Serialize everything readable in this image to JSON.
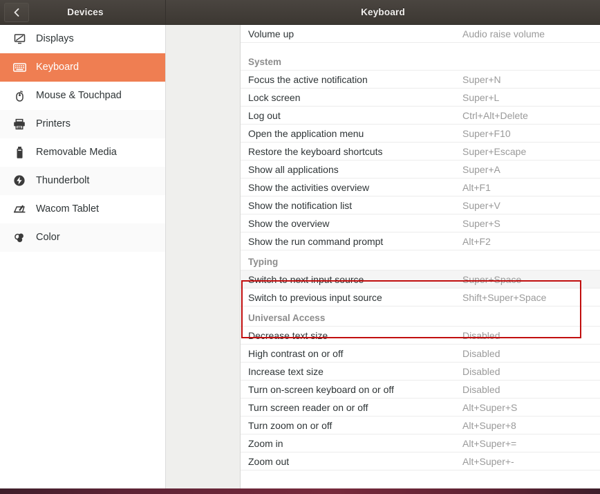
{
  "titlebar": {
    "back_icon": "chevron-left-icon",
    "left_title": "Devices",
    "right_title": "Keyboard"
  },
  "sidebar": {
    "items": [
      {
        "label": "Displays",
        "icon": "display-icon",
        "selected": false
      },
      {
        "label": "Keyboard",
        "icon": "keyboard-icon",
        "selected": true
      },
      {
        "label": "Mouse & Touchpad",
        "icon": "mouse-icon",
        "selected": false
      },
      {
        "label": "Printers",
        "icon": "printer-icon",
        "selected": false
      },
      {
        "label": "Removable Media",
        "icon": "usb-drive-icon",
        "selected": false
      },
      {
        "label": "Thunderbolt",
        "icon": "thunderbolt-icon",
        "selected": false
      },
      {
        "label": "Wacom Tablet",
        "icon": "wacom-tablet-icon",
        "selected": false
      },
      {
        "label": "Color",
        "icon": "color-profile-icon",
        "selected": false
      }
    ]
  },
  "shortcuts": {
    "rows": [
      {
        "type": "row",
        "action": "Volume up",
        "key": "Audio raise volume"
      },
      {
        "type": "section",
        "action": "System",
        "key": ""
      },
      {
        "type": "row",
        "action": "Focus the active notification",
        "key": "Super+N"
      },
      {
        "type": "row",
        "action": "Lock screen",
        "key": "Super+L"
      },
      {
        "type": "row",
        "action": "Log out",
        "key": "Ctrl+Alt+Delete"
      },
      {
        "type": "row",
        "action": "Open the application menu",
        "key": "Super+F10"
      },
      {
        "type": "row",
        "action": "Restore the keyboard shortcuts",
        "key": "Super+Escape"
      },
      {
        "type": "row",
        "action": "Show all applications",
        "key": "Super+A"
      },
      {
        "type": "row",
        "action": "Show the activities overview",
        "key": "Alt+F1"
      },
      {
        "type": "row",
        "action": "Show the notification list",
        "key": "Super+V"
      },
      {
        "type": "row",
        "action": "Show the overview",
        "key": "Super+S"
      },
      {
        "type": "row",
        "action": "Show the run command prompt",
        "key": "Alt+F2"
      },
      {
        "type": "section",
        "action": "Typing",
        "key": ""
      },
      {
        "type": "row",
        "action": "Switch to next input source",
        "key": "Super+Space",
        "hover": true
      },
      {
        "type": "row",
        "action": "Switch to previous input source",
        "key": "Shift+Super+Space"
      },
      {
        "type": "section",
        "action": "Universal Access",
        "key": ""
      },
      {
        "type": "row",
        "action": "Decrease text size",
        "key": "Disabled"
      },
      {
        "type": "row",
        "action": "High contrast on or off",
        "key": "Disabled"
      },
      {
        "type": "row",
        "action": "Increase text size",
        "key": "Disabled"
      },
      {
        "type": "row",
        "action": "Turn on-screen keyboard on or off",
        "key": "Disabled"
      },
      {
        "type": "row",
        "action": "Turn screen reader on or off",
        "key": "Alt+Super+S"
      },
      {
        "type": "row",
        "action": "Turn zoom on or off",
        "key": "Alt+Super+8"
      },
      {
        "type": "row",
        "action": "Zoom in",
        "key": "Alt+Super+="
      },
      {
        "type": "row",
        "action": "Zoom out",
        "key": "Alt+Super+-"
      }
    ]
  },
  "highlight": {
    "color": "#c10e0e",
    "label": "typing-section-highlight"
  },
  "colors": {
    "accent": "#ef7e52",
    "titlebar": "#413c37",
    "key_text": "#9a9a9a",
    "section_text": "#8d8d8d"
  }
}
